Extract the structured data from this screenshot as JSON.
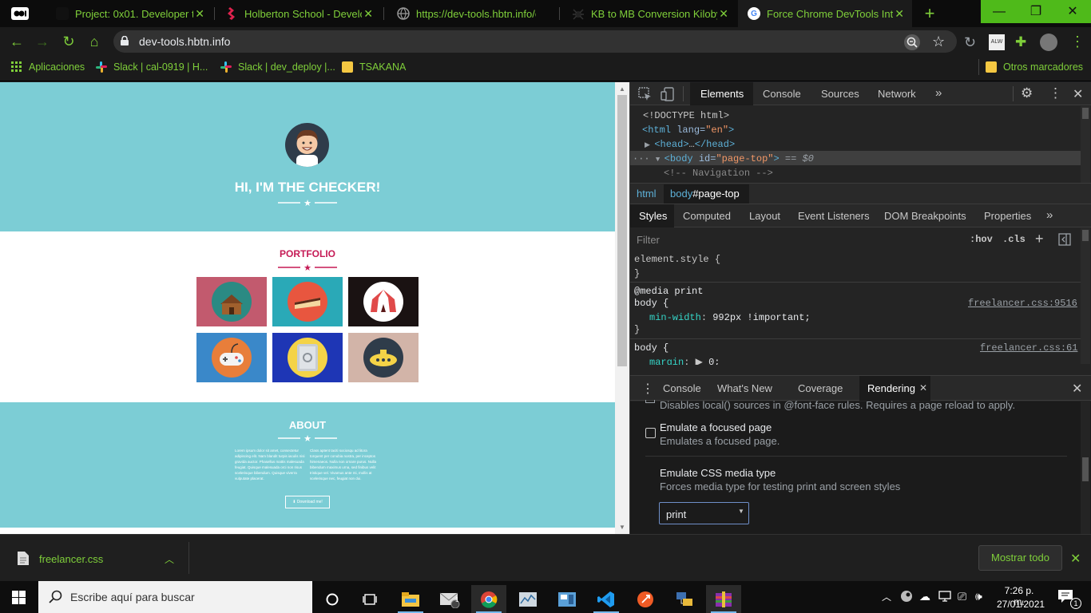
{
  "browser": {
    "tabs": [
      {
        "title": "Project: 0x01. Developer tools",
        "icon": "medium-icon"
      },
      {
        "title": "Holberton School - Developer",
        "icon": "holberton-icon"
      },
      {
        "title": "https://dev-tools.hbtn.info/css",
        "icon": "globe-icon"
      },
      {
        "title": "KB to MB Conversion Kilobyte",
        "icon": "spider-icon"
      },
      {
        "title": "Force Chrome DevTools Into",
        "icon": "google-icon"
      }
    ],
    "new_tab": "+",
    "url": "dev-tools.hbtn.info",
    "bookmarks": [
      "Aplicaciones",
      "Slack | cal-0919 | H...",
      "Slack | dev_deploy |...",
      "TSAKANA"
    ],
    "other_bookmarks": "Otros marcadores",
    "profile_badge": "ALW"
  },
  "site": {
    "hero_title": "HI, I'M THE CHECKER!",
    "portfolio_title": "PORTFOLIO",
    "portfolio_items": [
      {
        "icon": "cabin-icon",
        "bg": "#c25a6e"
      },
      {
        "icon": "cake-icon",
        "bg": "#2aa9b7"
      },
      {
        "icon": "circus-tent-icon",
        "bg": "#1a1212"
      },
      {
        "icon": "game-controller-icon",
        "bg": "#3a88c9"
      },
      {
        "icon": "safe-icon",
        "bg": "#1e36b5"
      },
      {
        "icon": "submarine-icon",
        "bg": "#d2b4a8"
      }
    ],
    "about_title": "ABOUT",
    "about_col1": "Lorem ipsum dolor sit amet, consectetur adipiscing elit. Nam blandit turpis iaculis nisi gravida auctor. Phasellus mattis malesuada feugiat. Quisque malesuada orci non risus scelerisque bibendum. Quisque viverra vulputate placerat.",
    "about_col2": "Class aptent taciti sociosqu ad litora torquent per conubia nostra, per inceptos himenaeos. Nulla non ornare purus. Nulla bibendum maximus urna, sed finibus velit tristique vel. Vivamus ante mi, mollis at scelerisque nec, feugiat non dui.",
    "download_label": "Download me!"
  },
  "devtools": {
    "main_tabs": [
      "Elements",
      "Console",
      "Sources",
      "Network"
    ],
    "dom": {
      "doctype": "<!DOCTYPE html>",
      "html_open_tag": "html",
      "html_lang_attr": "lang",
      "html_lang_value": "\"en\"",
      "head": "head",
      "head_ellipsis": "…",
      "body_tag": "body",
      "body_attr": "id",
      "body_value": "\"page-top\"",
      "body_suffix": "== $0",
      "comment": "<!-- Navigation -->"
    },
    "breadcrumbs": [
      "html",
      "body",
      "#page-top"
    ],
    "style_tabs": [
      "Styles",
      "Computed",
      "Layout",
      "Event Listeners",
      "DOM Breakpoints",
      "Properties"
    ],
    "filter_placeholder": "Filter",
    "hov": ":hov",
    "cls": ".cls",
    "element_style": "element.style {",
    "close_brace": "}",
    "media_rule": "@media print",
    "body_selector": "body",
    "open_brace": "{",
    "rule1_source": "freelancer.css:9516",
    "rule1_prop": "min-width",
    "rule1_value": "992px !important;",
    "rule2_source": "freelancer.css:61",
    "rule2_prop": "margin",
    "rule2_value": "0;",
    "drawer_tabs": [
      "Console",
      "What's New",
      "Coverage",
      "Rendering"
    ],
    "rendering": {
      "prev_desc": "Disables local() sources in @font-face rules. Requires a page reload to apply.",
      "focus_title": "Emulate a focused page",
      "focus_desc": "Emulates a focused page.",
      "media_title": "Emulate CSS media type",
      "media_desc": "Forces media type for testing print and screen styles",
      "media_value": "print"
    }
  },
  "downloads": {
    "file": "freelancer.css",
    "show_all": "Mostrar todo"
  },
  "taskbar": {
    "search_placeholder": "Escribe aquí para buscar",
    "time": "7:26 p. m.",
    "date": "27/01/2021",
    "mail_badge": "1",
    "notif_badge": "1"
  }
}
